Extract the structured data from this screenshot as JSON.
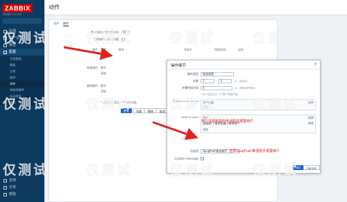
{
  "sidebar": {
    "logo": "ZABBIX",
    "logo_sub": "Zabbix server",
    "items": [
      {
        "label": "监测",
        "active": false
      },
      {
        "label": "资产记录",
        "active": false
      },
      {
        "label": "报告",
        "active": false
      },
      {
        "label": "配置",
        "active": true
      }
    ],
    "sub_items": [
      "主机群组",
      "模板",
      "主机",
      "维护",
      "动作",
      "关联项事件",
      "自动发现",
      "服务"
    ],
    "sub_selected": 4,
    "bottom": [
      "支持",
      "分享",
      "帮助"
    ]
  },
  "header": {
    "title": "动作"
  },
  "main": {
    "tabs": [
      "动作",
      "操作"
    ],
    "rows": [
      {
        "label": "默认操作步骤持续时间",
        "value": "1h"
      },
      {
        "label": "暂停操作以制止问题",
        "value": "✓"
      },
      {
        "label": "操作",
        "col1": "步骤",
        "col2": "细节",
        "col3": "开始于",
        "col4": "持续时间",
        "col5": "动作"
      },
      {
        "label": "恢复操作",
        "col1": "细节"
      },
      {
        "label": "更新操作",
        "col1": "细节"
      }
    ],
    "add_link": "添加",
    "note": "* 必须至少设置一个执行内容。",
    "update_button": "更新",
    "clone_button": "克隆",
    "delete_button": "删除",
    "cancel_button": "取消"
  },
  "dialog": {
    "title": "操作细节",
    "close": "×",
    "op_type_label": "操作类型",
    "op_type_value": "发送消息",
    "steps_label": "步骤",
    "steps_from": "1",
    "steps_to": "1",
    "steps_hint": "(0 - 无穷大)",
    "duration_label": "步骤持续时间",
    "duration_value": "0",
    "duration_hint": "(0 - 使用动作默认)",
    "must_note": "* 至少选定至少一个用户或用户组。",
    "send_groups_label": "Send to user groups",
    "send_groups_cols": [
      "用户群组",
      "动作"
    ],
    "send_users_label": "Send to users",
    "send_users_cols": [
      "用户",
      "动作"
    ],
    "send_users_row": "运维部门-报警机器人报警用户",
    "remove": "移除",
    "add": "添加",
    "only_send_label": "仅送到",
    "only_send_value": "SpugPush推送助手",
    "custom_msg_label": "Custom message",
    "note_users": "用户选择新建的电话短信报警用户",
    "note_media": "选择SpugPush推送助手报警媒介",
    "add_button": "Add",
    "cancel_button": "Cancel"
  },
  "watermark": "仅测试",
  "colors": {
    "accent": "#e0231f",
    "sidebar": "#0e3a5f",
    "primary": "#1f65c9"
  }
}
